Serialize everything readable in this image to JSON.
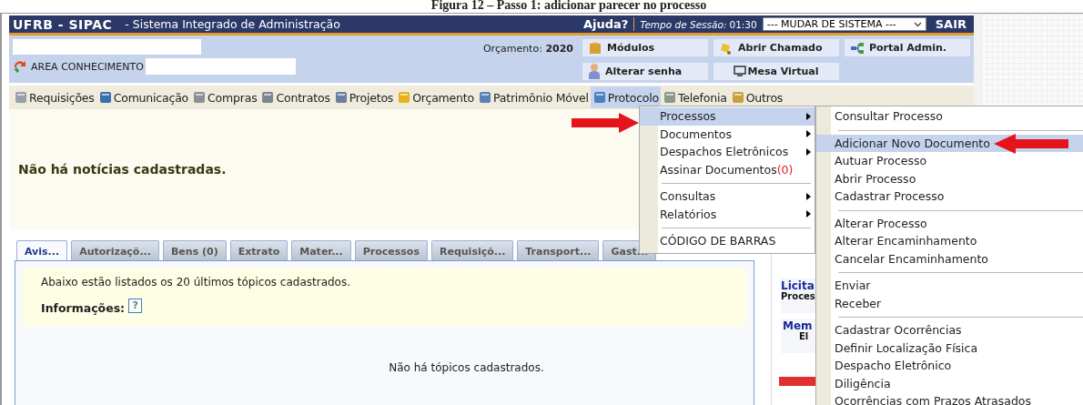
{
  "caption": "Figura 12 – Passo 1: adicionar parecer no processo",
  "header": {
    "system": "UFRB - SIPAC",
    "subtitle": "- Sistema Integrado de Administração",
    "help": "Ajuda?",
    "session_label": "Tempo de Sessão:",
    "session_time": "01:30",
    "system_select": "--- MUDAR DE SISTEMA ---",
    "logout": "SAIR"
  },
  "user_bar": {
    "area_label": "AREA CONHECIMENTO",
    "budget_label": "Orçamento:",
    "budget_year": "2020",
    "buttons": [
      {
        "label": "Módulos"
      },
      {
        "label": "Abrir Chamado"
      },
      {
        "label": "Portal Admin."
      },
      {
        "label": "Alterar senha"
      },
      {
        "label": "Mesa Virtual"
      }
    ]
  },
  "menu_bar": [
    {
      "label": "Requisições",
      "selected": false
    },
    {
      "label": "Comunicação",
      "selected": false
    },
    {
      "label": "Compras",
      "selected": false
    },
    {
      "label": "Contratos",
      "selected": false
    },
    {
      "label": "Projetos",
      "selected": false
    },
    {
      "label": "Orçamento",
      "selected": false
    },
    {
      "label": "Patrimônio Móvel",
      "selected": false
    },
    {
      "label": "Protocolo",
      "selected": true
    },
    {
      "label": "Telefonia",
      "selected": false
    },
    {
      "label": "Outros",
      "selected": false
    }
  ],
  "news": "Não há notícias cadastradas.",
  "tabs": [
    {
      "label": "Avis...",
      "selected": true
    },
    {
      "label": "Autorizaçõ...",
      "selected": false
    },
    {
      "label": "Bens (0)",
      "selected": false
    },
    {
      "label": "Extrato",
      "selected": false
    },
    {
      "label": "Mater...",
      "selected": false
    },
    {
      "label": "Processos",
      "selected": false
    },
    {
      "label": "Requisiçõ...",
      "selected": false
    },
    {
      "label": "Transport...",
      "selected": false
    },
    {
      "label": "Gast...",
      "selected": false
    }
  ],
  "tab_content": {
    "intro": "Abaixo estão listados os 20 últimos tópicos cadastrados.",
    "info_label": "Informações:",
    "help_icon": "?",
    "empty": "Não há tópicos cadastrados."
  },
  "side_panel": [
    {
      "title": "Licita",
      "subtitle": "Proces"
    },
    {
      "title": "Mem",
      "subtitle": "El"
    }
  ],
  "menu": {
    "groups": [
      {
        "items": [
          {
            "label": "Processos",
            "selected": true,
            "submenu": true
          },
          {
            "label": "Documentos",
            "selected": false,
            "submenu": true
          },
          {
            "label": "Despachos Eletrônicos",
            "selected": false,
            "submenu": true
          },
          {
            "label": "Assinar Documentos",
            "count": "(0)",
            "selected": false,
            "submenu": false
          }
        ]
      },
      {
        "items": [
          {
            "label": "Consultas",
            "selected": false,
            "submenu": true
          },
          {
            "label": "Relatórios",
            "selected": false,
            "submenu": true
          }
        ]
      },
      {
        "items": [
          {
            "label": "CÓDIGO DE BARRAS",
            "selected": false,
            "submenu": false
          }
        ]
      }
    ]
  },
  "submenu": {
    "groups": [
      {
        "items": [
          {
            "label": "Consultar Processo",
            "selected": false
          }
        ]
      },
      {
        "items": [
          {
            "label": "Adicionar Novo Documento",
            "selected": true
          },
          {
            "label": "Autuar Processo",
            "selected": false
          },
          {
            "label": "Abrir Processo",
            "selected": false
          },
          {
            "label": "Cadastrar Processo",
            "selected": false
          }
        ]
      },
      {
        "items": [
          {
            "label": "Alterar Processo",
            "selected": false
          },
          {
            "label": "Alterar Encaminhamento",
            "selected": false
          },
          {
            "label": "Cancelar Encaminhamento",
            "selected": false
          }
        ]
      },
      {
        "items": [
          {
            "label": "Enviar",
            "selected": false
          },
          {
            "label": "Receber",
            "selected": false
          }
        ]
      },
      {
        "items": [
          {
            "label": "Cadastrar Ocorrências",
            "selected": false
          },
          {
            "label": "Definir Localização Física",
            "selected": false
          },
          {
            "label": "Despacho Eletrônico",
            "selected": false
          },
          {
            "label": "Diligência",
            "selected": false
          },
          {
            "label": "Ocorrências com Prazos Atrasados",
            "selected": false
          }
        ]
      }
    ]
  }
}
